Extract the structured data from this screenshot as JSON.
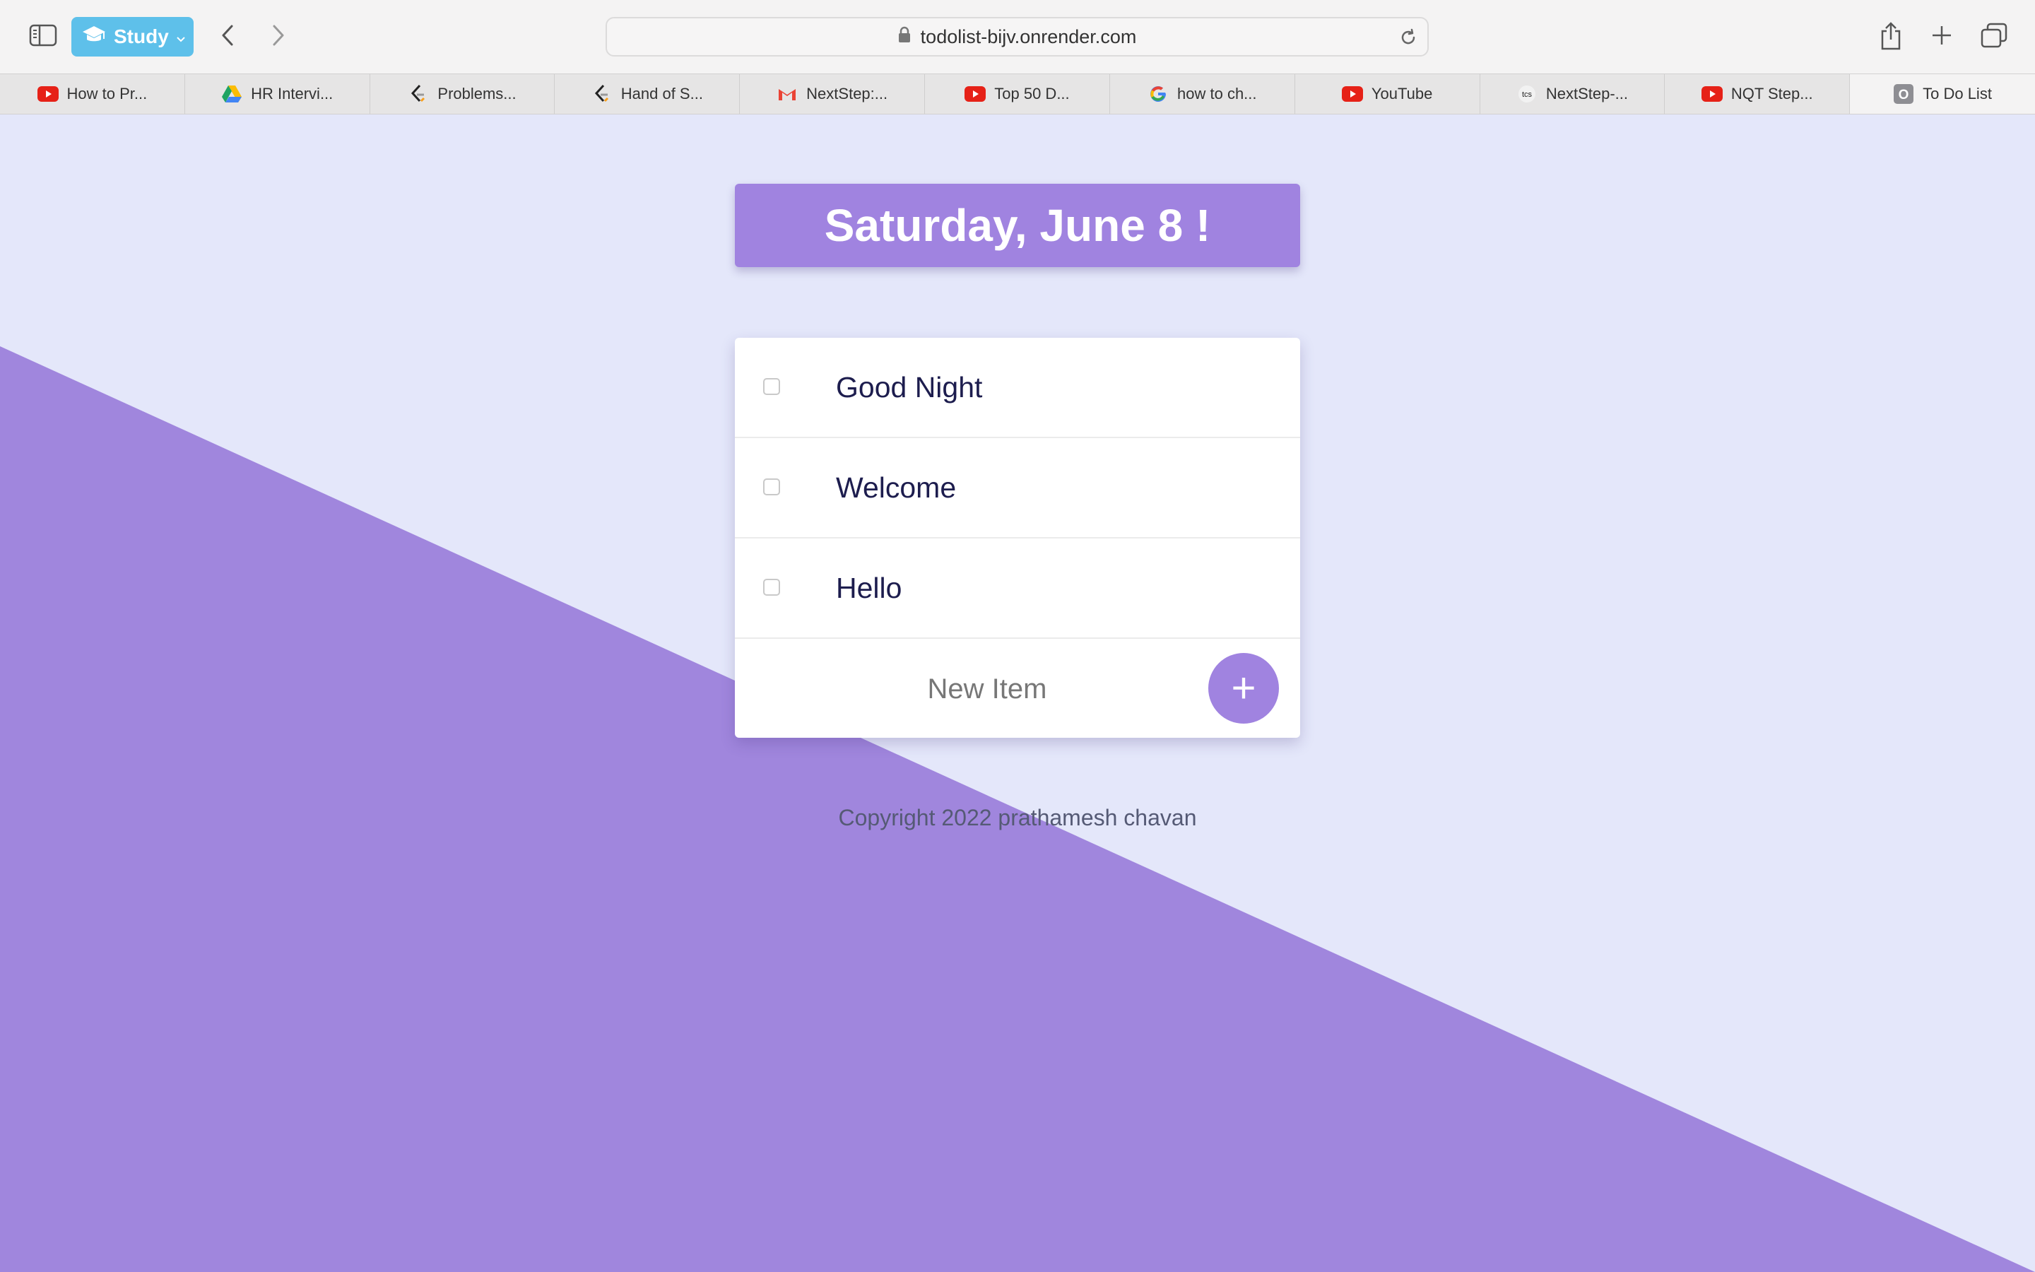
{
  "browser": {
    "tab_group": "Study",
    "url": "todolist-bijv.onrender.com",
    "accent_color": "#5ec0ea",
    "tabs": [
      {
        "title": "How to Pr...",
        "icon": "youtube-icon"
      },
      {
        "title": "HR Intervi...",
        "icon": "google-drive-icon"
      },
      {
        "title": "Problems...",
        "icon": "leetcode-icon"
      },
      {
        "title": "Hand of S...",
        "icon": "leetcode-icon"
      },
      {
        "title": "NextStep:...",
        "icon": "gmail-icon"
      },
      {
        "title": "Top 50 D...",
        "icon": "youtube-icon"
      },
      {
        "title": "how to ch...",
        "icon": "google-icon"
      },
      {
        "title": "YouTube",
        "icon": "youtube-icon"
      },
      {
        "title": "NextStep-...",
        "icon": "tcs-icon"
      },
      {
        "title": "NQT Step...",
        "icon": "youtube-icon"
      },
      {
        "title": "To Do List",
        "icon": "letter-o-icon",
        "active": true
      }
    ]
  },
  "todo": {
    "heading": "Saturday, June 8 !",
    "items": [
      {
        "text": "Good Night",
        "checked": false
      },
      {
        "text": "Welcome",
        "checked": false
      },
      {
        "text": "Hello",
        "checked": false
      }
    ],
    "new_item_placeholder": "New Item",
    "add_button_label": "+",
    "accent_color": "#a083e0"
  },
  "footer": {
    "text": "Copyright 2022 prathamesh chavan"
  }
}
